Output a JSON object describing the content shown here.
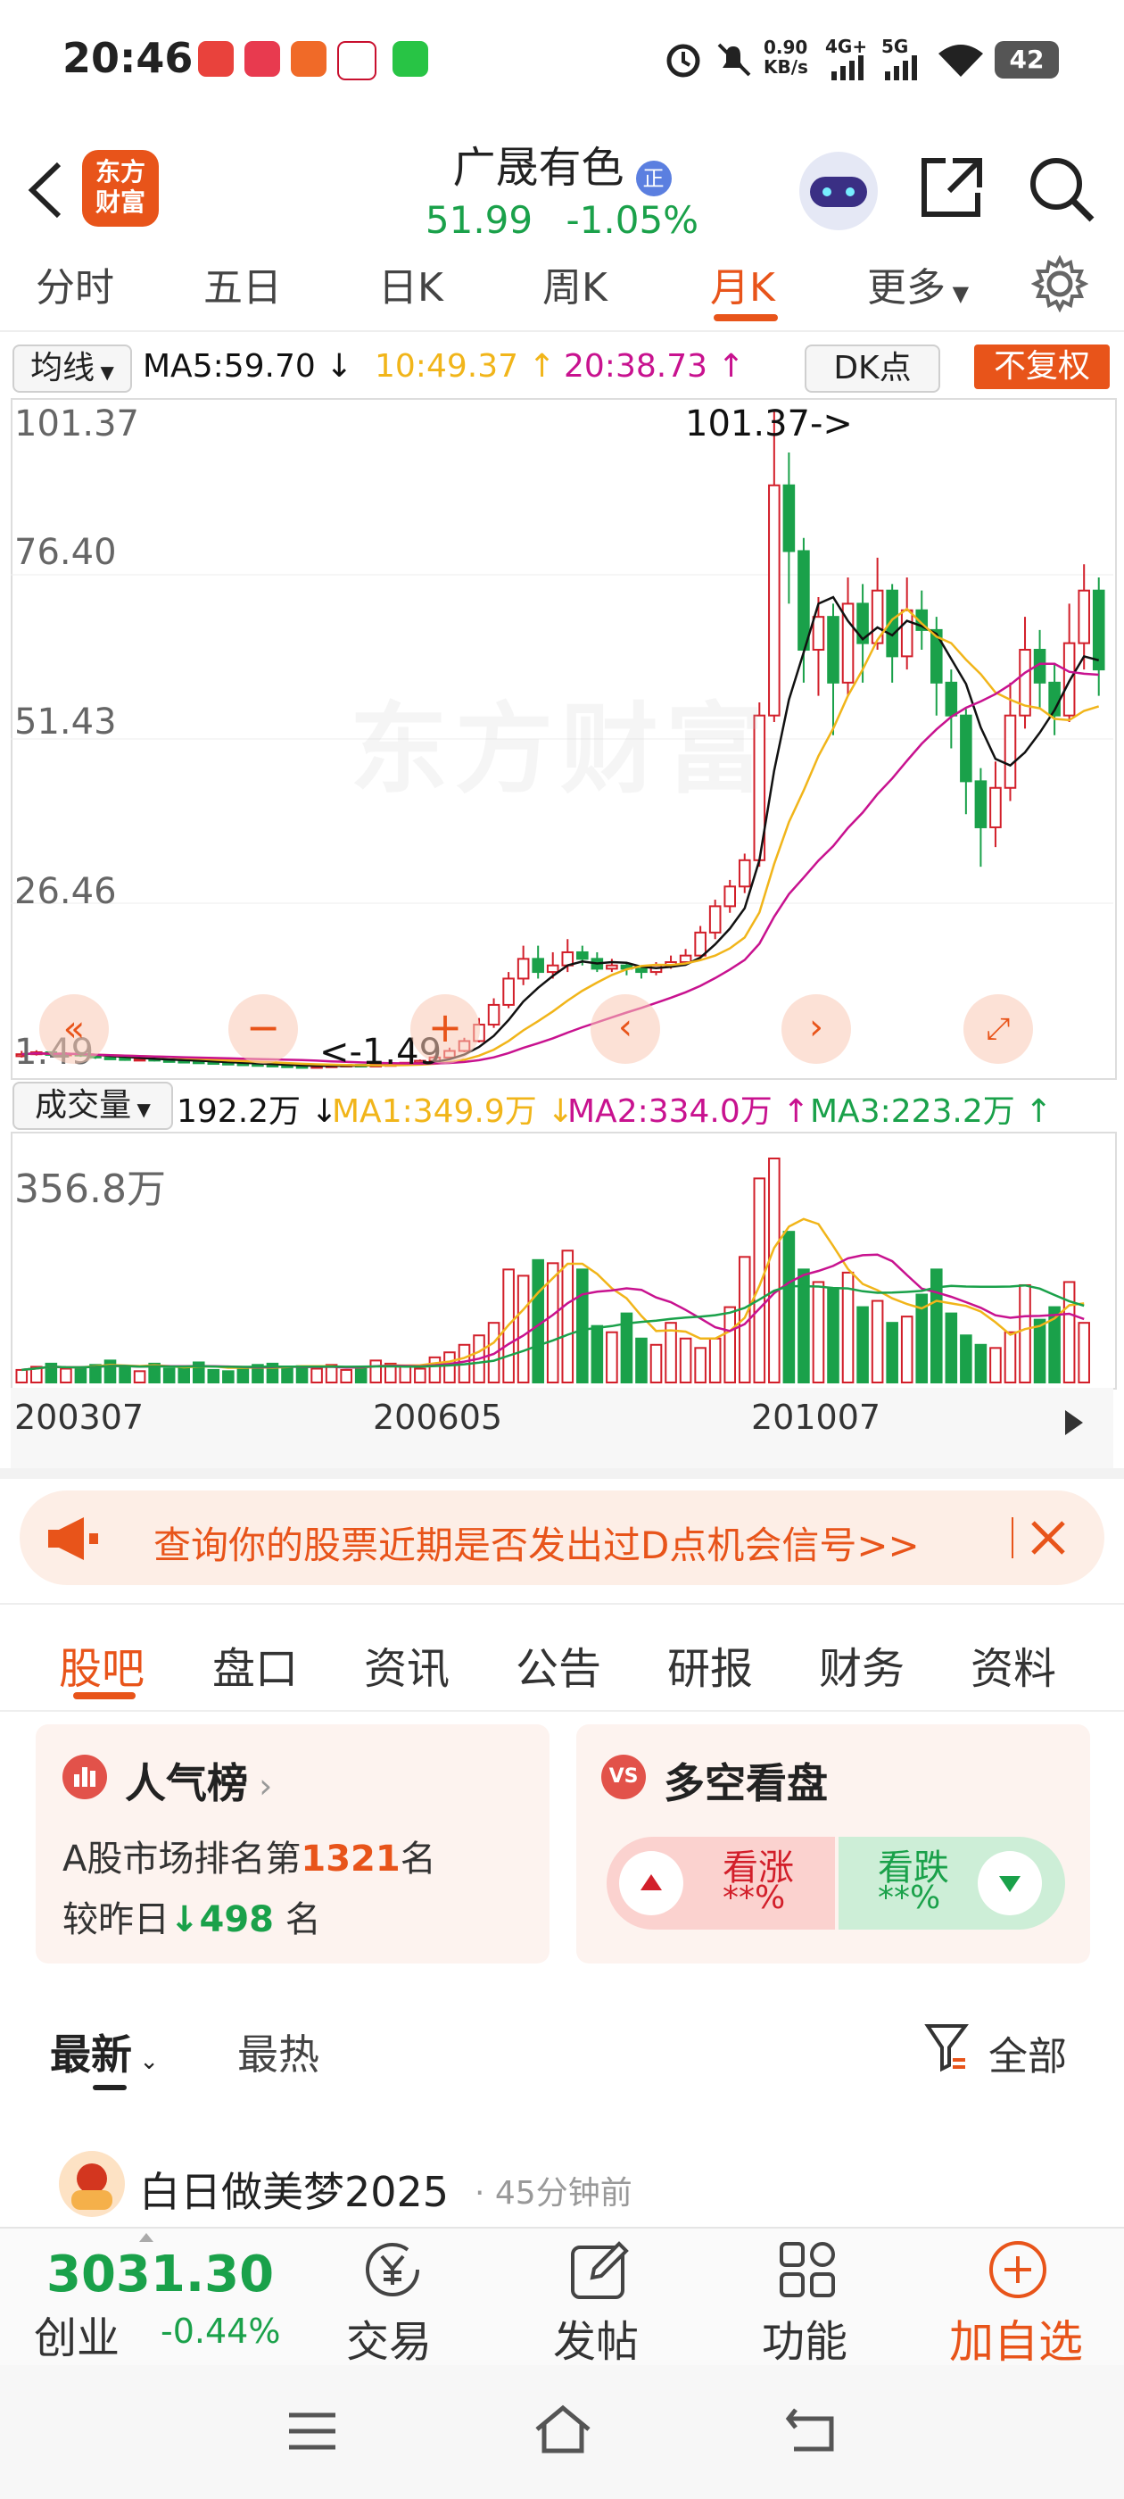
{
  "status": {
    "time": "20:46",
    "net_speed": "0.90 KB/s",
    "net1": "4G+",
    "net2": "5G",
    "battery": "42"
  },
  "header": {
    "logo_text": "东方财富",
    "stock_name": "广晟有色",
    "badge": "正",
    "price": "51.99",
    "change_pct": "-1.05%"
  },
  "period_tabs": [
    "分时",
    "五日",
    "日K",
    "周K",
    "月K",
    "更多"
  ],
  "active_period": "月K",
  "indicators": {
    "ma_label": "均线",
    "ma5": "MA5:59.70",
    "ma10": "10:49.37",
    "ma20": "20:38.73",
    "dk": "DK点",
    "fq": "不复权"
  },
  "price_axis": [
    "101.37",
    "76.40",
    "51.43",
    "26.46",
    "1.49"
  ],
  "annotations": {
    "high": "101.37->",
    "low": "<-1.49"
  },
  "watermark": "东方财富",
  "volume": {
    "label": "成交量",
    "current": "192.2万",
    "ma1": "MA1:349.9万",
    "ma2": "MA2:334.0万",
    "ma3": "MA3:223.2万",
    "axis_max": "356.8万"
  },
  "time_axis": [
    "200307",
    "200605",
    "201007"
  ],
  "colors": {
    "up": "#d21f2a",
    "down": "#1aa14a",
    "accent": "#e8541a",
    "ma5": "#111111",
    "ma10": "#f1b51a",
    "ma20": "#c8128f"
  },
  "banner_text": "查询你的股票近期是否发出过D点机会信号>>",
  "section_tabs": [
    "股吧",
    "盘口",
    "资讯",
    "公告",
    "研报",
    "财务",
    "资料"
  ],
  "active_section": "股吧",
  "popularity": {
    "title": "人气榜",
    "rank_prefix": "A股市场排名第",
    "rank": "1321",
    "rank_suffix": "名",
    "change_prefix": "较昨日",
    "change": "498",
    "change_suffix": "名"
  },
  "duokong": {
    "title": "多空看盘",
    "up_label": "看涨",
    "up_val": "**%",
    "down_label": "看跌",
    "down_val": "**%"
  },
  "feed_tabs": {
    "latest": "最新",
    "hot": "最热",
    "filter": "全部"
  },
  "post": {
    "user": "白日做美梦2025",
    "time": "· 45分钟前"
  },
  "bottom": {
    "index_value": "3031.30",
    "index_name": "创业",
    "index_change": "-0.44%",
    "trade": "交易",
    "post": "发帖",
    "func": "功能",
    "add": "加自选"
  },
  "chart_data": {
    "type": "candlestick",
    "title": "",
    "ylim": [
      1.49,
      101.37
    ],
    "x_ticks": [
      "200307",
      "200605",
      "201007"
    ],
    "candles": [
      [
        3.2,
        3.5,
        4.0,
        3.0
      ],
      [
        3.5,
        3.8,
        4.1,
        3.3
      ],
      [
        3.8,
        3.4,
        3.9,
        3.2
      ],
      [
        3.4,
        3.6,
        3.8,
        3.1
      ],
      [
        3.6,
        3.3,
        3.7,
        3.1
      ],
      [
        3.3,
        3.0,
        3.4,
        2.8
      ],
      [
        3.0,
        2.9,
        3.2,
        2.7
      ],
      [
        2.9,
        2.7,
        3.0,
        2.5
      ],
      [
        2.7,
        2.8,
        3.0,
        2.6
      ],
      [
        2.8,
        2.6,
        2.9,
        2.4
      ],
      [
        2.6,
        2.5,
        2.7,
        2.3
      ],
      [
        2.5,
        2.4,
        2.6,
        2.2
      ],
      [
        2.4,
        2.3,
        2.5,
        2.1
      ],
      [
        2.3,
        2.2,
        2.4,
        2.0
      ],
      [
        2.2,
        2.1,
        2.3,
        1.9
      ],
      [
        2.1,
        2.0,
        2.2,
        1.8
      ],
      [
        2.0,
        1.9,
        2.1,
        1.7
      ],
      [
        1.9,
        1.8,
        2.0,
        1.6
      ],
      [
        1.8,
        1.7,
        1.9,
        1.5
      ],
      [
        1.7,
        1.6,
        1.8,
        1.49
      ],
      [
        1.6,
        1.7,
        1.8,
        1.5
      ],
      [
        1.7,
        1.8,
        1.9,
        1.6
      ],
      [
        1.8,
        1.9,
        2.0,
        1.7
      ],
      [
        1.9,
        1.8,
        2.0,
        1.7
      ],
      [
        1.8,
        1.9,
        2.0,
        1.7
      ],
      [
        1.9,
        2.0,
        2.1,
        1.8
      ],
      [
        2.0,
        2.2,
        2.3,
        1.9
      ],
      [
        2.2,
        2.5,
        2.7,
        2.1
      ],
      [
        2.5,
        3.0,
        3.3,
        2.4
      ],
      [
        3.0,
        4.0,
        4.5,
        2.9
      ],
      [
        4.0,
        5.5,
        6.0,
        3.8
      ],
      [
        5.5,
        8.0,
        9.0,
        5.3
      ],
      [
        8.0,
        11.0,
        12.0,
        7.5
      ],
      [
        11.0,
        15.0,
        16.0,
        10.5
      ],
      [
        15.0,
        18.0,
        20.0,
        14.0
      ],
      [
        18.0,
        16.0,
        20.0,
        15.0
      ],
      [
        16.0,
        17.0,
        19.0,
        15.0
      ],
      [
        17.0,
        19.0,
        21.0,
        16.0
      ],
      [
        19.0,
        18.0,
        20.0,
        17.0
      ],
      [
        18.0,
        16.5,
        19.0,
        16.0
      ],
      [
        16.5,
        17.0,
        18.0,
        16.0
      ],
      [
        17.0,
        16.5,
        17.5,
        15.5
      ],
      [
        16.5,
        16.0,
        17.0,
        15.0
      ],
      [
        16.0,
        17.0,
        17.5,
        15.5
      ],
      [
        17.0,
        17.5,
        18.5,
        16.5
      ],
      [
        17.5,
        18.5,
        19.5,
        17.0
      ],
      [
        18.5,
        22.0,
        23.0,
        18.0
      ],
      [
        22.0,
        26.0,
        27.0,
        21.0
      ],
      [
        26.0,
        29.0,
        30.0,
        25.0
      ],
      [
        29.0,
        33.0,
        34.0,
        28.0
      ],
      [
        33.0,
        55.0,
        57.0,
        32.0
      ],
      [
        55.0,
        90.0,
        101.37,
        54.0
      ],
      [
        90.0,
        80.0,
        95.0,
        72.0
      ],
      [
        80.0,
        65.0,
        82.0,
        60.0
      ],
      [
        65.0,
        70.0,
        73.0,
        58.0
      ],
      [
        70.0,
        60.0,
        72.0,
        52.0
      ],
      [
        60.0,
        72.0,
        76.0,
        58.0
      ],
      [
        72.0,
        66.0,
        75.0,
        60.0
      ],
      [
        66.0,
        74.0,
        79.0,
        65.0
      ],
      [
        74.0,
        64.0,
        75.0,
        60.0
      ],
      [
        64.0,
        71.0,
        76.0,
        62.0
      ],
      [
        71.0,
        68.0,
        74.0,
        65.0
      ],
      [
        68.0,
        60.0,
        70.0,
        55.0
      ],
      [
        60.0,
        55.0,
        62.0,
        50.0
      ],
      [
        55.0,
        45.0,
        56.0,
        40.0
      ],
      [
        45.0,
        38.0,
        47.0,
        32.0
      ],
      [
        38.0,
        44.0,
        48.0,
        35.0
      ],
      [
        44.0,
        55.0,
        60.0,
        42.0
      ],
      [
        55.0,
        65.0,
        70.0,
        53.0
      ],
      [
        65.0,
        60.0,
        68.0,
        56.0
      ],
      [
        60.0,
        55.0,
        63.0,
        52.0
      ],
      [
        55.0,
        66.0,
        72.0,
        54.0
      ],
      [
        66.0,
        74.0,
        78.0,
        62.0
      ],
      [
        74.0,
        62.0,
        76.0,
        58.0
      ]
    ],
    "volume": [
      20,
      25,
      30,
      22,
      24,
      28,
      35,
      26,
      18,
      30,
      22,
      25,
      32,
      20,
      18,
      22,
      28,
      30,
      24,
      26,
      22,
      28,
      20,
      24,
      35,
      30,
      26,
      22,
      40,
      48,
      60,
      75,
      95,
      180,
      170,
      195,
      190,
      210,
      180,
      90,
      80,
      110,
      70,
      60,
      95,
      70,
      55,
      70,
      120,
      200,
      325,
      356.8,
      240,
      180,
      160,
      150,
      175,
      120,
      130,
      95,
      105,
      140,
      180,
      110,
      75,
      60,
      55,
      80,
      155,
      100,
      120,
      160,
      95
    ]
  }
}
